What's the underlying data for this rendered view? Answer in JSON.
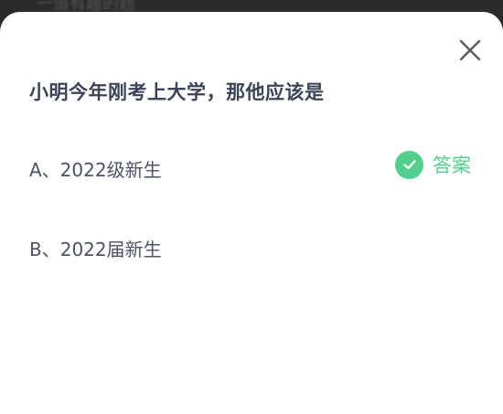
{
  "background_text": "一道有趣的题",
  "colors": {
    "accent_green": "#4fd18b",
    "question_text": "#3a4358",
    "option_text": "#4a5266",
    "close_icon": "#5a5a5a"
  },
  "dialog": {
    "question": "小明今年刚考上大学，那他应该是",
    "options": [
      {
        "label": "A、2022级新生",
        "is_answer": true
      },
      {
        "label": "B、2022届新生",
        "is_answer": false
      }
    ],
    "answer_label": "答案",
    "close_icon": "close-icon",
    "check_icon": "check-icon"
  }
}
